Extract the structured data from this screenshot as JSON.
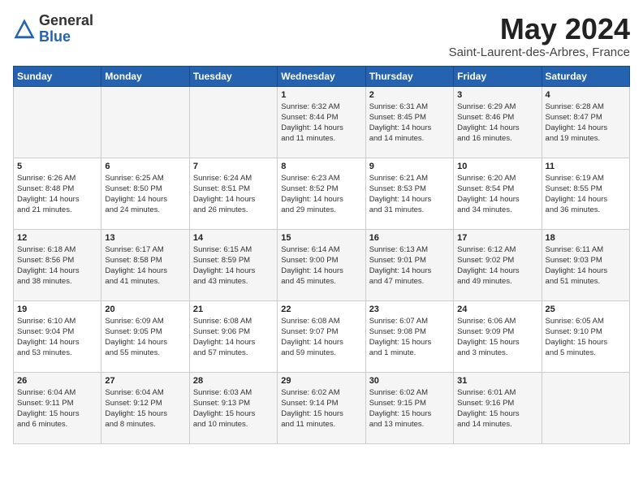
{
  "header": {
    "logo_general": "General",
    "logo_blue": "Blue",
    "month_title": "May 2024",
    "subtitle": "Saint-Laurent-des-Arbres, France"
  },
  "weekdays": [
    "Sunday",
    "Monday",
    "Tuesday",
    "Wednesday",
    "Thursday",
    "Friday",
    "Saturday"
  ],
  "weeks": [
    [
      {
        "day": "",
        "info": ""
      },
      {
        "day": "",
        "info": ""
      },
      {
        "day": "",
        "info": ""
      },
      {
        "day": "1",
        "info": "Sunrise: 6:32 AM\nSunset: 8:44 PM\nDaylight: 14 hours\nand 11 minutes."
      },
      {
        "day": "2",
        "info": "Sunrise: 6:31 AM\nSunset: 8:45 PM\nDaylight: 14 hours\nand 14 minutes."
      },
      {
        "day": "3",
        "info": "Sunrise: 6:29 AM\nSunset: 8:46 PM\nDaylight: 14 hours\nand 16 minutes."
      },
      {
        "day": "4",
        "info": "Sunrise: 6:28 AM\nSunset: 8:47 PM\nDaylight: 14 hours\nand 19 minutes."
      }
    ],
    [
      {
        "day": "5",
        "info": "Sunrise: 6:26 AM\nSunset: 8:48 PM\nDaylight: 14 hours\nand 21 minutes."
      },
      {
        "day": "6",
        "info": "Sunrise: 6:25 AM\nSunset: 8:50 PM\nDaylight: 14 hours\nand 24 minutes."
      },
      {
        "day": "7",
        "info": "Sunrise: 6:24 AM\nSunset: 8:51 PM\nDaylight: 14 hours\nand 26 minutes."
      },
      {
        "day": "8",
        "info": "Sunrise: 6:23 AM\nSunset: 8:52 PM\nDaylight: 14 hours\nand 29 minutes."
      },
      {
        "day": "9",
        "info": "Sunrise: 6:21 AM\nSunset: 8:53 PM\nDaylight: 14 hours\nand 31 minutes."
      },
      {
        "day": "10",
        "info": "Sunrise: 6:20 AM\nSunset: 8:54 PM\nDaylight: 14 hours\nand 34 minutes."
      },
      {
        "day": "11",
        "info": "Sunrise: 6:19 AM\nSunset: 8:55 PM\nDaylight: 14 hours\nand 36 minutes."
      }
    ],
    [
      {
        "day": "12",
        "info": "Sunrise: 6:18 AM\nSunset: 8:56 PM\nDaylight: 14 hours\nand 38 minutes."
      },
      {
        "day": "13",
        "info": "Sunrise: 6:17 AM\nSunset: 8:58 PM\nDaylight: 14 hours\nand 41 minutes."
      },
      {
        "day": "14",
        "info": "Sunrise: 6:15 AM\nSunset: 8:59 PM\nDaylight: 14 hours\nand 43 minutes."
      },
      {
        "day": "15",
        "info": "Sunrise: 6:14 AM\nSunset: 9:00 PM\nDaylight: 14 hours\nand 45 minutes."
      },
      {
        "day": "16",
        "info": "Sunrise: 6:13 AM\nSunset: 9:01 PM\nDaylight: 14 hours\nand 47 minutes."
      },
      {
        "day": "17",
        "info": "Sunrise: 6:12 AM\nSunset: 9:02 PM\nDaylight: 14 hours\nand 49 minutes."
      },
      {
        "day": "18",
        "info": "Sunrise: 6:11 AM\nSunset: 9:03 PM\nDaylight: 14 hours\nand 51 minutes."
      }
    ],
    [
      {
        "day": "19",
        "info": "Sunrise: 6:10 AM\nSunset: 9:04 PM\nDaylight: 14 hours\nand 53 minutes."
      },
      {
        "day": "20",
        "info": "Sunrise: 6:09 AM\nSunset: 9:05 PM\nDaylight: 14 hours\nand 55 minutes."
      },
      {
        "day": "21",
        "info": "Sunrise: 6:08 AM\nSunset: 9:06 PM\nDaylight: 14 hours\nand 57 minutes."
      },
      {
        "day": "22",
        "info": "Sunrise: 6:08 AM\nSunset: 9:07 PM\nDaylight: 14 hours\nand 59 minutes."
      },
      {
        "day": "23",
        "info": "Sunrise: 6:07 AM\nSunset: 9:08 PM\nDaylight: 15 hours\nand 1 minute."
      },
      {
        "day": "24",
        "info": "Sunrise: 6:06 AM\nSunset: 9:09 PM\nDaylight: 15 hours\nand 3 minutes."
      },
      {
        "day": "25",
        "info": "Sunrise: 6:05 AM\nSunset: 9:10 PM\nDaylight: 15 hours\nand 5 minutes."
      }
    ],
    [
      {
        "day": "26",
        "info": "Sunrise: 6:04 AM\nSunset: 9:11 PM\nDaylight: 15 hours\nand 6 minutes."
      },
      {
        "day": "27",
        "info": "Sunrise: 6:04 AM\nSunset: 9:12 PM\nDaylight: 15 hours\nand 8 minutes."
      },
      {
        "day": "28",
        "info": "Sunrise: 6:03 AM\nSunset: 9:13 PM\nDaylight: 15 hours\nand 10 minutes."
      },
      {
        "day": "29",
        "info": "Sunrise: 6:02 AM\nSunset: 9:14 PM\nDaylight: 15 hours\nand 11 minutes."
      },
      {
        "day": "30",
        "info": "Sunrise: 6:02 AM\nSunset: 9:15 PM\nDaylight: 15 hours\nand 13 minutes."
      },
      {
        "day": "31",
        "info": "Sunrise: 6:01 AM\nSunset: 9:16 PM\nDaylight: 15 hours\nand 14 minutes."
      },
      {
        "day": "",
        "info": ""
      }
    ]
  ]
}
